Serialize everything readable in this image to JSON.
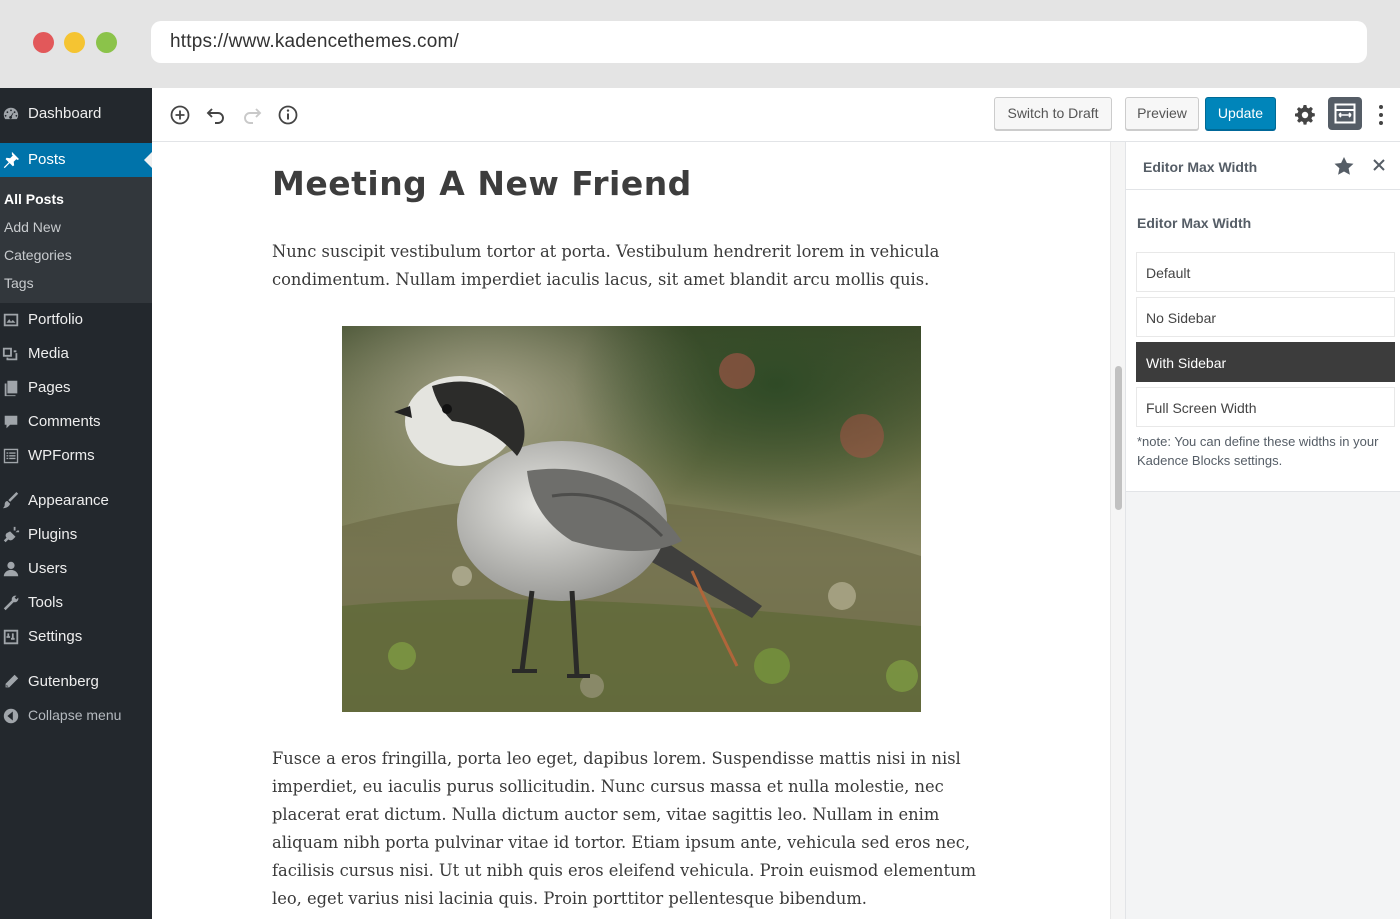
{
  "browser": {
    "url": "https://www.kadencethemes.com/"
  },
  "admin_menu": {
    "items": [
      {
        "label": "Dashboard",
        "icon": "dashboard-icon"
      },
      {
        "label": "Posts",
        "icon": "pin-icon"
      },
      {
        "label": "Portfolio",
        "icon": "portfolio-icon"
      },
      {
        "label": "Media",
        "icon": "media-icon"
      },
      {
        "label": "Pages",
        "icon": "pages-icon"
      },
      {
        "label": "Comments",
        "icon": "comments-icon"
      },
      {
        "label": "WPForms",
        "icon": "wpforms-icon"
      },
      {
        "label": "Appearance",
        "icon": "brush-icon"
      },
      {
        "label": "Plugins",
        "icon": "plugin-icon"
      },
      {
        "label": "Users",
        "icon": "user-icon"
      },
      {
        "label": "Tools",
        "icon": "wrench-icon"
      },
      {
        "label": "Settings",
        "icon": "settings-icon"
      },
      {
        "label": "Gutenberg",
        "icon": "pencil-icon"
      },
      {
        "label": "Collapse menu",
        "icon": "collapse-icon"
      }
    ],
    "posts_submenu": [
      "All Posts",
      "Add New",
      "Categories",
      "Tags"
    ]
  },
  "toolbar": {
    "switch_to_draft": "Switch to Draft",
    "preview": "Preview",
    "update": "Update"
  },
  "post": {
    "title": "Meeting A New Friend",
    "paragraph1": "Nunc suscipit vestibulum tortor at porta. Vestibulum hendrerit lorem in vehicula condimentum. Nullam imperdiet iaculis lacus, sit amet blandit arcu mollis quis.",
    "paragraph2": "Fusce a eros fringilla, porta leo eget, dapibus lorem. Suspendisse mattis nisi in nisl imperdiet, eu iaculis purus sollicitudin. Nunc cursus massa et nulla molestie, nec placerat erat dictum. Nulla dictum auctor sem, vitae sagittis leo. Nullam in enim aliquam nibh porta pulvinar vitae id tortor. Etiam ipsum ante, vehicula sed eros nec, facilisis cursus nisi. Ut ut nibh quis eros eleifend vehicula. Proin euismod elementum leo, eget varius nisi lacinia quis. Proin porttitor pellentesque bibendum."
  },
  "panel": {
    "header_title": "Editor Max Width",
    "section_title": "Editor Max Width",
    "options": [
      "Default",
      "No Sidebar",
      "With Sidebar",
      "Full Screen Width"
    ],
    "selected": "With Sidebar",
    "note": "*note: You can define these widths in your Kadence Blocks settings."
  },
  "colors": {
    "admin_bg": "#23282d",
    "active_blue": "#0073aa",
    "update_button": "#0085ba",
    "selected_option": "#3c3c3c"
  }
}
